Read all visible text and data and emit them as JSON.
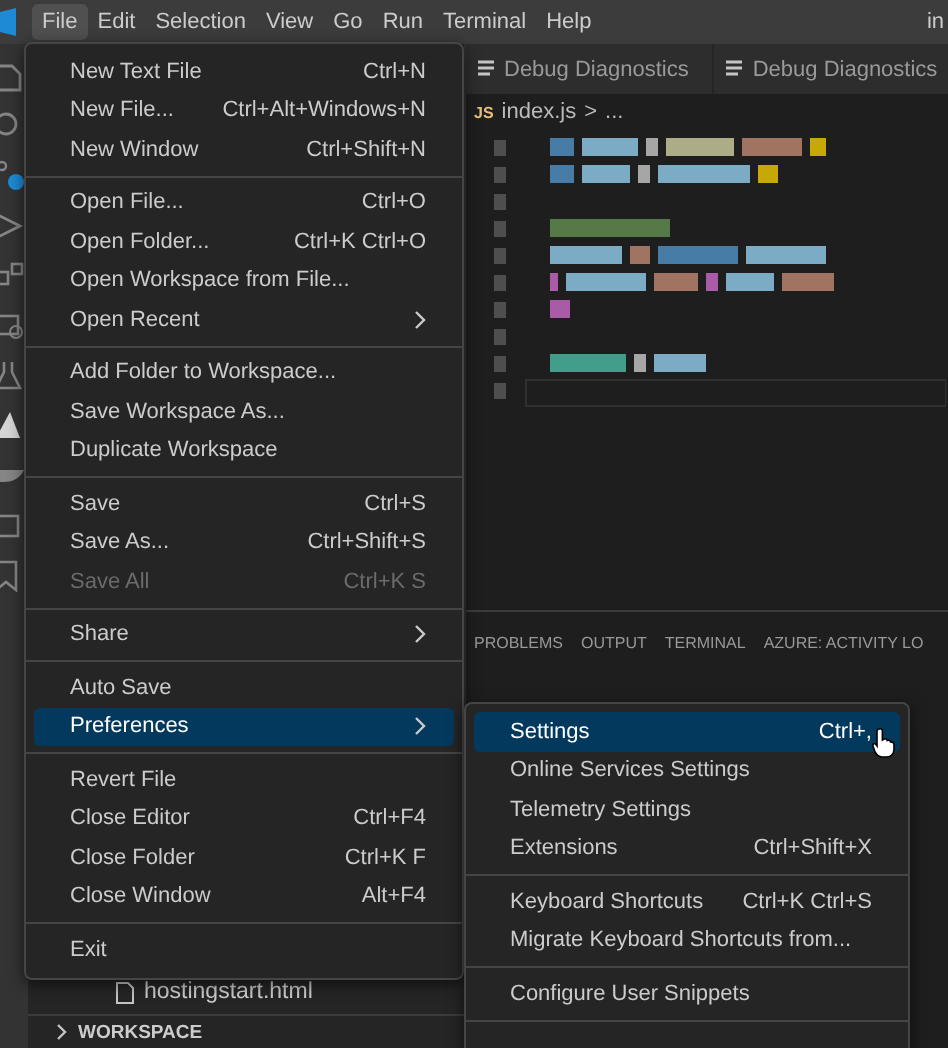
{
  "menubar": [
    {
      "label": "File",
      "selected": true
    },
    {
      "label": "Edit",
      "selected": false
    },
    {
      "label": "Selection",
      "selected": false
    },
    {
      "label": "View",
      "selected": false
    },
    {
      "label": "Go",
      "selected": false
    },
    {
      "label": "Run",
      "selected": false
    },
    {
      "label": "Terminal",
      "selected": false
    },
    {
      "label": "Help",
      "selected": false
    }
  ],
  "window": {
    "title": "in"
  },
  "editor_tabs": [
    {
      "label": "Debug Diagnostics",
      "selected": false
    },
    {
      "label": "Debug Diagnostics",
      "selected": false
    }
  ],
  "breadcrumb": {
    "icon": "JS",
    "file": "index.js",
    "separator": ">",
    "rest": "..."
  },
  "panel_tabs": [
    {
      "label": "PROBLEMS",
      "selected": false
    },
    {
      "label": "OUTPUT",
      "selected": false
    },
    {
      "label": "TERMINAL",
      "selected": false
    },
    {
      "label": "AZURE: ACTIVITY LO",
      "selected": false
    }
  ],
  "sidebar": {
    "file": "hostingstart.html",
    "section": "WORKSPACE",
    "expanded": false
  },
  "file_menu": [
    [
      {
        "label": "New Text File",
        "shortcut": "Ctrl+N",
        "disabled": false,
        "submenu": false,
        "selected": false
      },
      {
        "label": "New File...",
        "shortcut": "Ctrl+Alt+Windows+N",
        "disabled": false,
        "submenu": false,
        "selected": false
      },
      {
        "label": "New Window",
        "shortcut": "Ctrl+Shift+N",
        "disabled": false,
        "submenu": false,
        "selected": false
      }
    ],
    [
      {
        "label": "Open File...",
        "shortcut": "Ctrl+O",
        "disabled": false,
        "submenu": false,
        "selected": false
      },
      {
        "label": "Open Folder...",
        "shortcut": "Ctrl+K Ctrl+O",
        "disabled": false,
        "submenu": false,
        "selected": false
      },
      {
        "label": "Open Workspace from File...",
        "disabled": false,
        "submenu": false,
        "selected": false
      },
      {
        "label": "Open Recent",
        "disabled": false,
        "submenu": true,
        "selected": false
      }
    ],
    [
      {
        "label": "Add Folder to Workspace...",
        "disabled": false,
        "submenu": false,
        "selected": false
      },
      {
        "label": "Save Workspace As...",
        "disabled": false,
        "submenu": false,
        "selected": false
      },
      {
        "label": "Duplicate Workspace",
        "disabled": false,
        "submenu": false,
        "selected": false
      }
    ],
    [
      {
        "label": "Save",
        "shortcut": "Ctrl+S",
        "disabled": false,
        "submenu": false,
        "selected": false
      },
      {
        "label": "Save As...",
        "shortcut": "Ctrl+Shift+S",
        "disabled": false,
        "submenu": false,
        "selected": false
      },
      {
        "label": "Save All",
        "shortcut": "Ctrl+K S",
        "disabled": true,
        "submenu": false,
        "selected": false
      }
    ],
    [
      {
        "label": "Share",
        "disabled": false,
        "submenu": true,
        "selected": false
      }
    ],
    [
      {
        "label": "Auto Save",
        "disabled": false,
        "submenu": false,
        "selected": false
      },
      {
        "label": "Preferences",
        "disabled": false,
        "submenu": true,
        "selected": true
      }
    ],
    [
      {
        "label": "Revert File",
        "disabled": false,
        "submenu": false,
        "selected": false
      },
      {
        "label": "Close Editor",
        "shortcut": "Ctrl+F4",
        "disabled": false,
        "submenu": false,
        "selected": false
      },
      {
        "label": "Close Folder",
        "shortcut": "Ctrl+K F",
        "disabled": false,
        "submenu": false,
        "selected": false
      },
      {
        "label": "Close Window",
        "shortcut": "Alt+F4",
        "disabled": false,
        "submenu": false,
        "selected": false
      }
    ],
    [
      {
        "label": "Exit",
        "disabled": false,
        "submenu": false,
        "selected": false
      }
    ]
  ],
  "preferences_menu": [
    [
      {
        "label": "Settings",
        "shortcut": "Ctrl+,",
        "selected": true
      },
      {
        "label": "Online Services Settings",
        "selected": false
      },
      {
        "label": "Telemetry Settings",
        "selected": false
      },
      {
        "label": "Extensions",
        "shortcut": "Ctrl+Shift+X",
        "selected": false
      }
    ],
    [
      {
        "label": "Keyboard Shortcuts",
        "shortcut": "Ctrl+K Ctrl+S",
        "selected": false
      },
      {
        "label": "Migrate Keyboard Shortcuts from...",
        "selected": false
      }
    ],
    [
      {
        "label": "Configure User Snippets",
        "selected": false
      }
    ]
  ]
}
